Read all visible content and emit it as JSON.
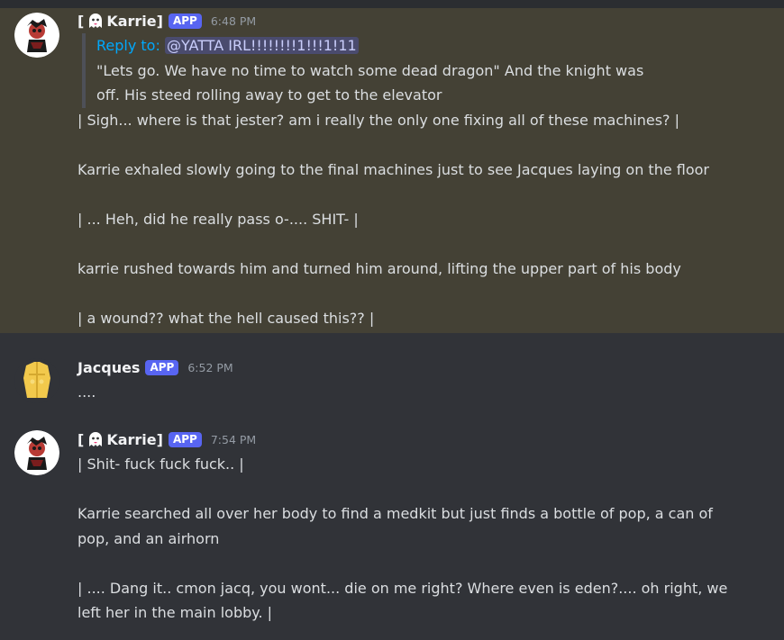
{
  "messages": [
    {
      "username": "[ 👻 Karrie]",
      "name_prefix": "[",
      "name_core": "Karrie]",
      "badge": "APP",
      "time": "6:48 PM",
      "reply": {
        "label": "Reply to:",
        "mention": "@YATTA IRL!!!!!!!!1!!!1!11",
        "lines": [
          "\"Lets go. We have no time to watch some dead dragon\"  And the knight was",
          "off. His steed rolling away to get to the elevator"
        ]
      },
      "lines": [
        "| Sigh... where is that jester? am i really the only one fixing all of these machines? |",
        "",
        "Karrie exhaled slowly going to the final machines just to see Jacques laying on the floor",
        "",
        "| ... Heh, did he really pass o-.... SHIT- |",
        "",
        "karrie rushed towards him and turned him around, lifting the upper part of his body",
        "",
        "| a wound?? what the hell caused this?? |"
      ]
    },
    {
      "username": "Jacques",
      "badge": "APP",
      "time": "6:52 PM",
      "lines": [
        "...."
      ]
    },
    {
      "username": "[ 👻 Karrie]",
      "name_prefix": "[",
      "name_core": "Karrie]",
      "badge": "APP",
      "time": "7:54 PM",
      "lines": [
        "| Shit- fuck fuck fuck.. |",
        "",
        "Karrie searched all over her body to find a medkit but just finds a bottle of pop, a can of",
        "pop, and an airhorn",
        "",
        "| .... Dang it.. cmon jacq, you wont... die on me right? Where even is eden?.... oh right, we",
        "left her in the main lobby. |"
      ]
    }
  ],
  "colors": {
    "background": "#313338",
    "highlight": "#444135",
    "badge": "#5865f2",
    "reply_link": "#00a8fc"
  },
  "icons": [
    "ghost-emoji",
    "karrie-avatar",
    "jacques-avatar"
  ]
}
